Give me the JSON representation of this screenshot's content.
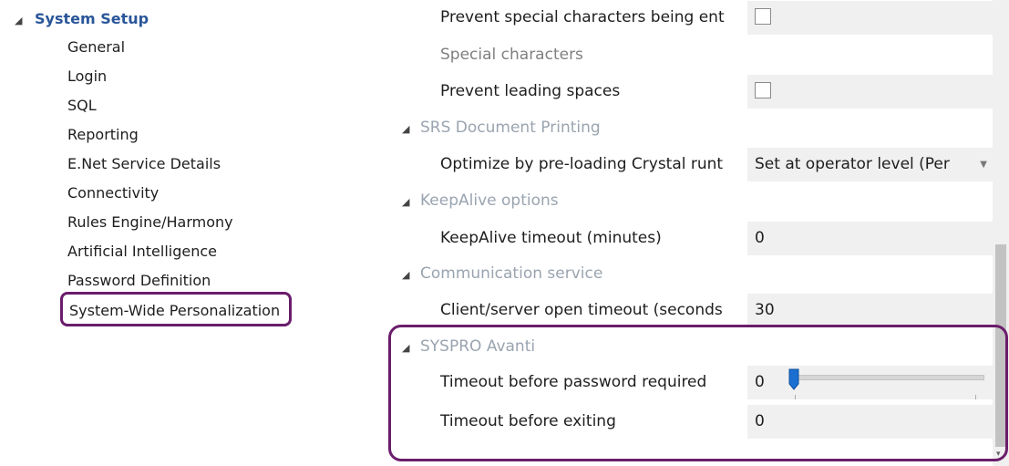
{
  "tree": {
    "root_label": "System Setup",
    "items": [
      {
        "label": "General"
      },
      {
        "label": "Login"
      },
      {
        "label": "SQL"
      },
      {
        "label": "Reporting"
      },
      {
        "label": "E.Net Service Details"
      },
      {
        "label": "Connectivity"
      },
      {
        "label": "Rules Engine/Harmony"
      },
      {
        "label": "Artificial Intelligence"
      },
      {
        "label": "Password Definition"
      },
      {
        "label": "System-Wide Personalization"
      }
    ],
    "selected": "System-Wide Personalization"
  },
  "grid": {
    "prevent_special": {
      "label": "Prevent special characters being ent",
      "checked": false
    },
    "special_chars": {
      "label": "Special characters"
    },
    "prevent_leading": {
      "label": "Prevent leading spaces",
      "checked": false
    },
    "cat_srs": "SRS Document Printing",
    "optimize": {
      "label": "Optimize by pre-loading Crystal runt",
      "value": "Set at operator level (Per"
    },
    "cat_keepalive": "KeepAlive options",
    "keepalive_timeout": {
      "label": "KeepAlive timeout (minutes)",
      "value": "0"
    },
    "cat_comm": "Communication service",
    "client_server": {
      "label": "Client/server open timeout (seconds",
      "value": "30"
    },
    "cat_avanti": "SYSPRO Avanti",
    "timeout_password": {
      "label": "Timeout before password required",
      "value": "0"
    },
    "timeout_exit": {
      "label": "Timeout before exiting",
      "value": "0"
    }
  },
  "colors": {
    "highlight_frame": "#6b1d6b",
    "tree_root": "#2a5699",
    "category_text": "#9aa4b0",
    "value_bg": "#f0f0f0"
  }
}
